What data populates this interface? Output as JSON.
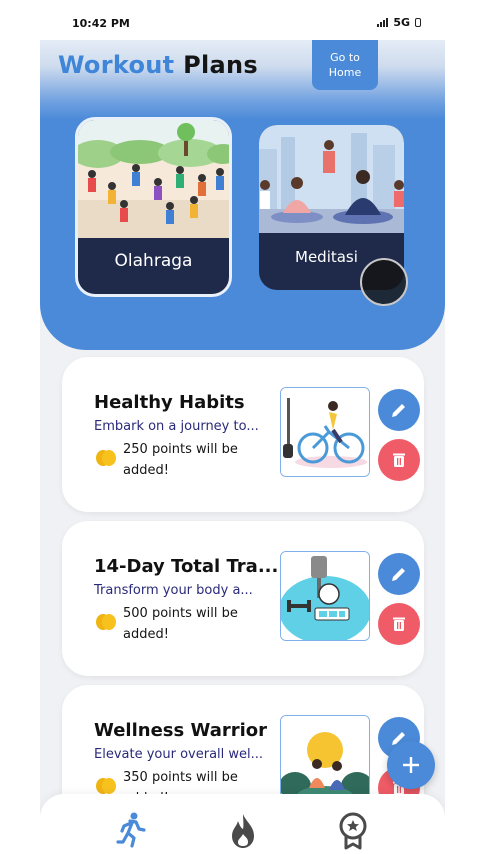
{
  "status": {
    "time": "10:42 PM",
    "network": "5G"
  },
  "header": {
    "title_part1": "Workout",
    "title_part2": "Plans",
    "home_button": [
      "Go to",
      "Home"
    ],
    "categories": [
      {
        "label": "Olahraga"
      },
      {
        "label": "Meditasi"
      }
    ]
  },
  "plans": [
    {
      "title": "Healthy Habits",
      "description": "Embark on a journey to...",
      "points_line1": "250 points will be",
      "points_line2": "added!"
    },
    {
      "title": "14-Day Total Tra...",
      "description": "Transform your body a...",
      "points_line1": "500 points will be",
      "points_line2": "added!"
    },
    {
      "title": "Wellness Warrior",
      "description": "Elevate your overall wel...",
      "points_line1": "350 points will be",
      "points_line2": "added!"
    }
  ],
  "icons": {
    "edit": "pencil-icon",
    "delete": "trash-icon",
    "fab": "plus-icon",
    "nav": [
      "running-icon",
      "flame-icon",
      "award-medal-icon"
    ]
  },
  "colors": {
    "primary": "#4a8ad8",
    "danger": "#ef5b67",
    "card_dark": "#1f2a4b",
    "coin": "#f7c21e"
  }
}
